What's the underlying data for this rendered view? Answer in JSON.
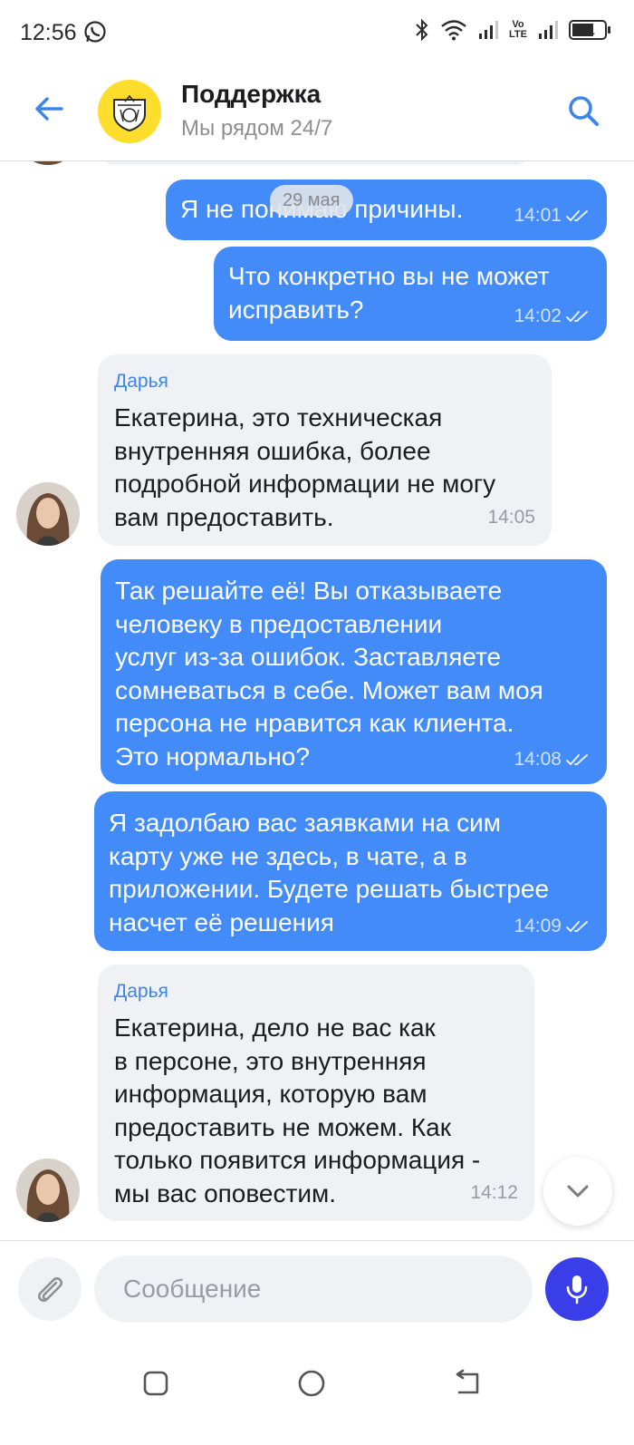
{
  "status_bar": {
    "time": "12:56",
    "volte_top": "Vo",
    "volte_bottom": "LTE",
    "battery": "61"
  },
  "header": {
    "title": "Поддержка",
    "subtitle": "Мы рядом 24/7"
  },
  "date_separator": "29 мая",
  "messages": [
    {
      "direction": "out",
      "text": "Я не понимаю причины.",
      "time": "14:01",
      "status_icon": "double-check-icon"
    },
    {
      "direction": "out",
      "text": "Что конкретно вы не может\nисправить?",
      "time": "14:02",
      "status_icon": "double-check-icon"
    },
    {
      "direction": "in",
      "sender": "Дарья",
      "text": "Екатерина, это техническая\nвнутренняя ошибка, более\nподробной информации не могу\nвам предоставить.",
      "time": "14:05"
    },
    {
      "direction": "out",
      "text": "Так решайте её! Вы отказываете\nчеловеку в предоставлении\nуслуг из-за ошибок. Заставляете\nсомневаться в себе. Может вам моя\nперсона не нравится как клиента.\nЭто нормально?",
      "time": "14:08",
      "status_icon": "double-check-icon"
    },
    {
      "direction": "out",
      "text": "Я задолбаю вас заявками на сим\nкарту уже не здесь, в чате, а в\nприложении. Будете решать быстрее\nнасчет её решения",
      "time": "14:09",
      "status_icon": "double-check-icon"
    },
    {
      "direction": "in",
      "sender": "Дарья",
      "text": "Екатерина, дело не вас как\nв персоне, это внутренняя\nинформация, которую вам\nпредоставить не можем. Как\nтолько появится информация -\nмы вас оповестим.",
      "time": "14:12"
    }
  ],
  "composer": {
    "placeholder": "Сообщение"
  },
  "colors": {
    "outgoing_bubble": "#428bf9",
    "incoming_bubble": "#f0f1f4",
    "accent": "#3a3ee8",
    "logo_yellow": "#ffdd2d"
  },
  "icons": {
    "back": "arrow-left-icon",
    "search": "search-icon",
    "attach": "paperclip-icon",
    "mic": "microphone-icon",
    "scroll_down": "chevron-down-icon"
  }
}
